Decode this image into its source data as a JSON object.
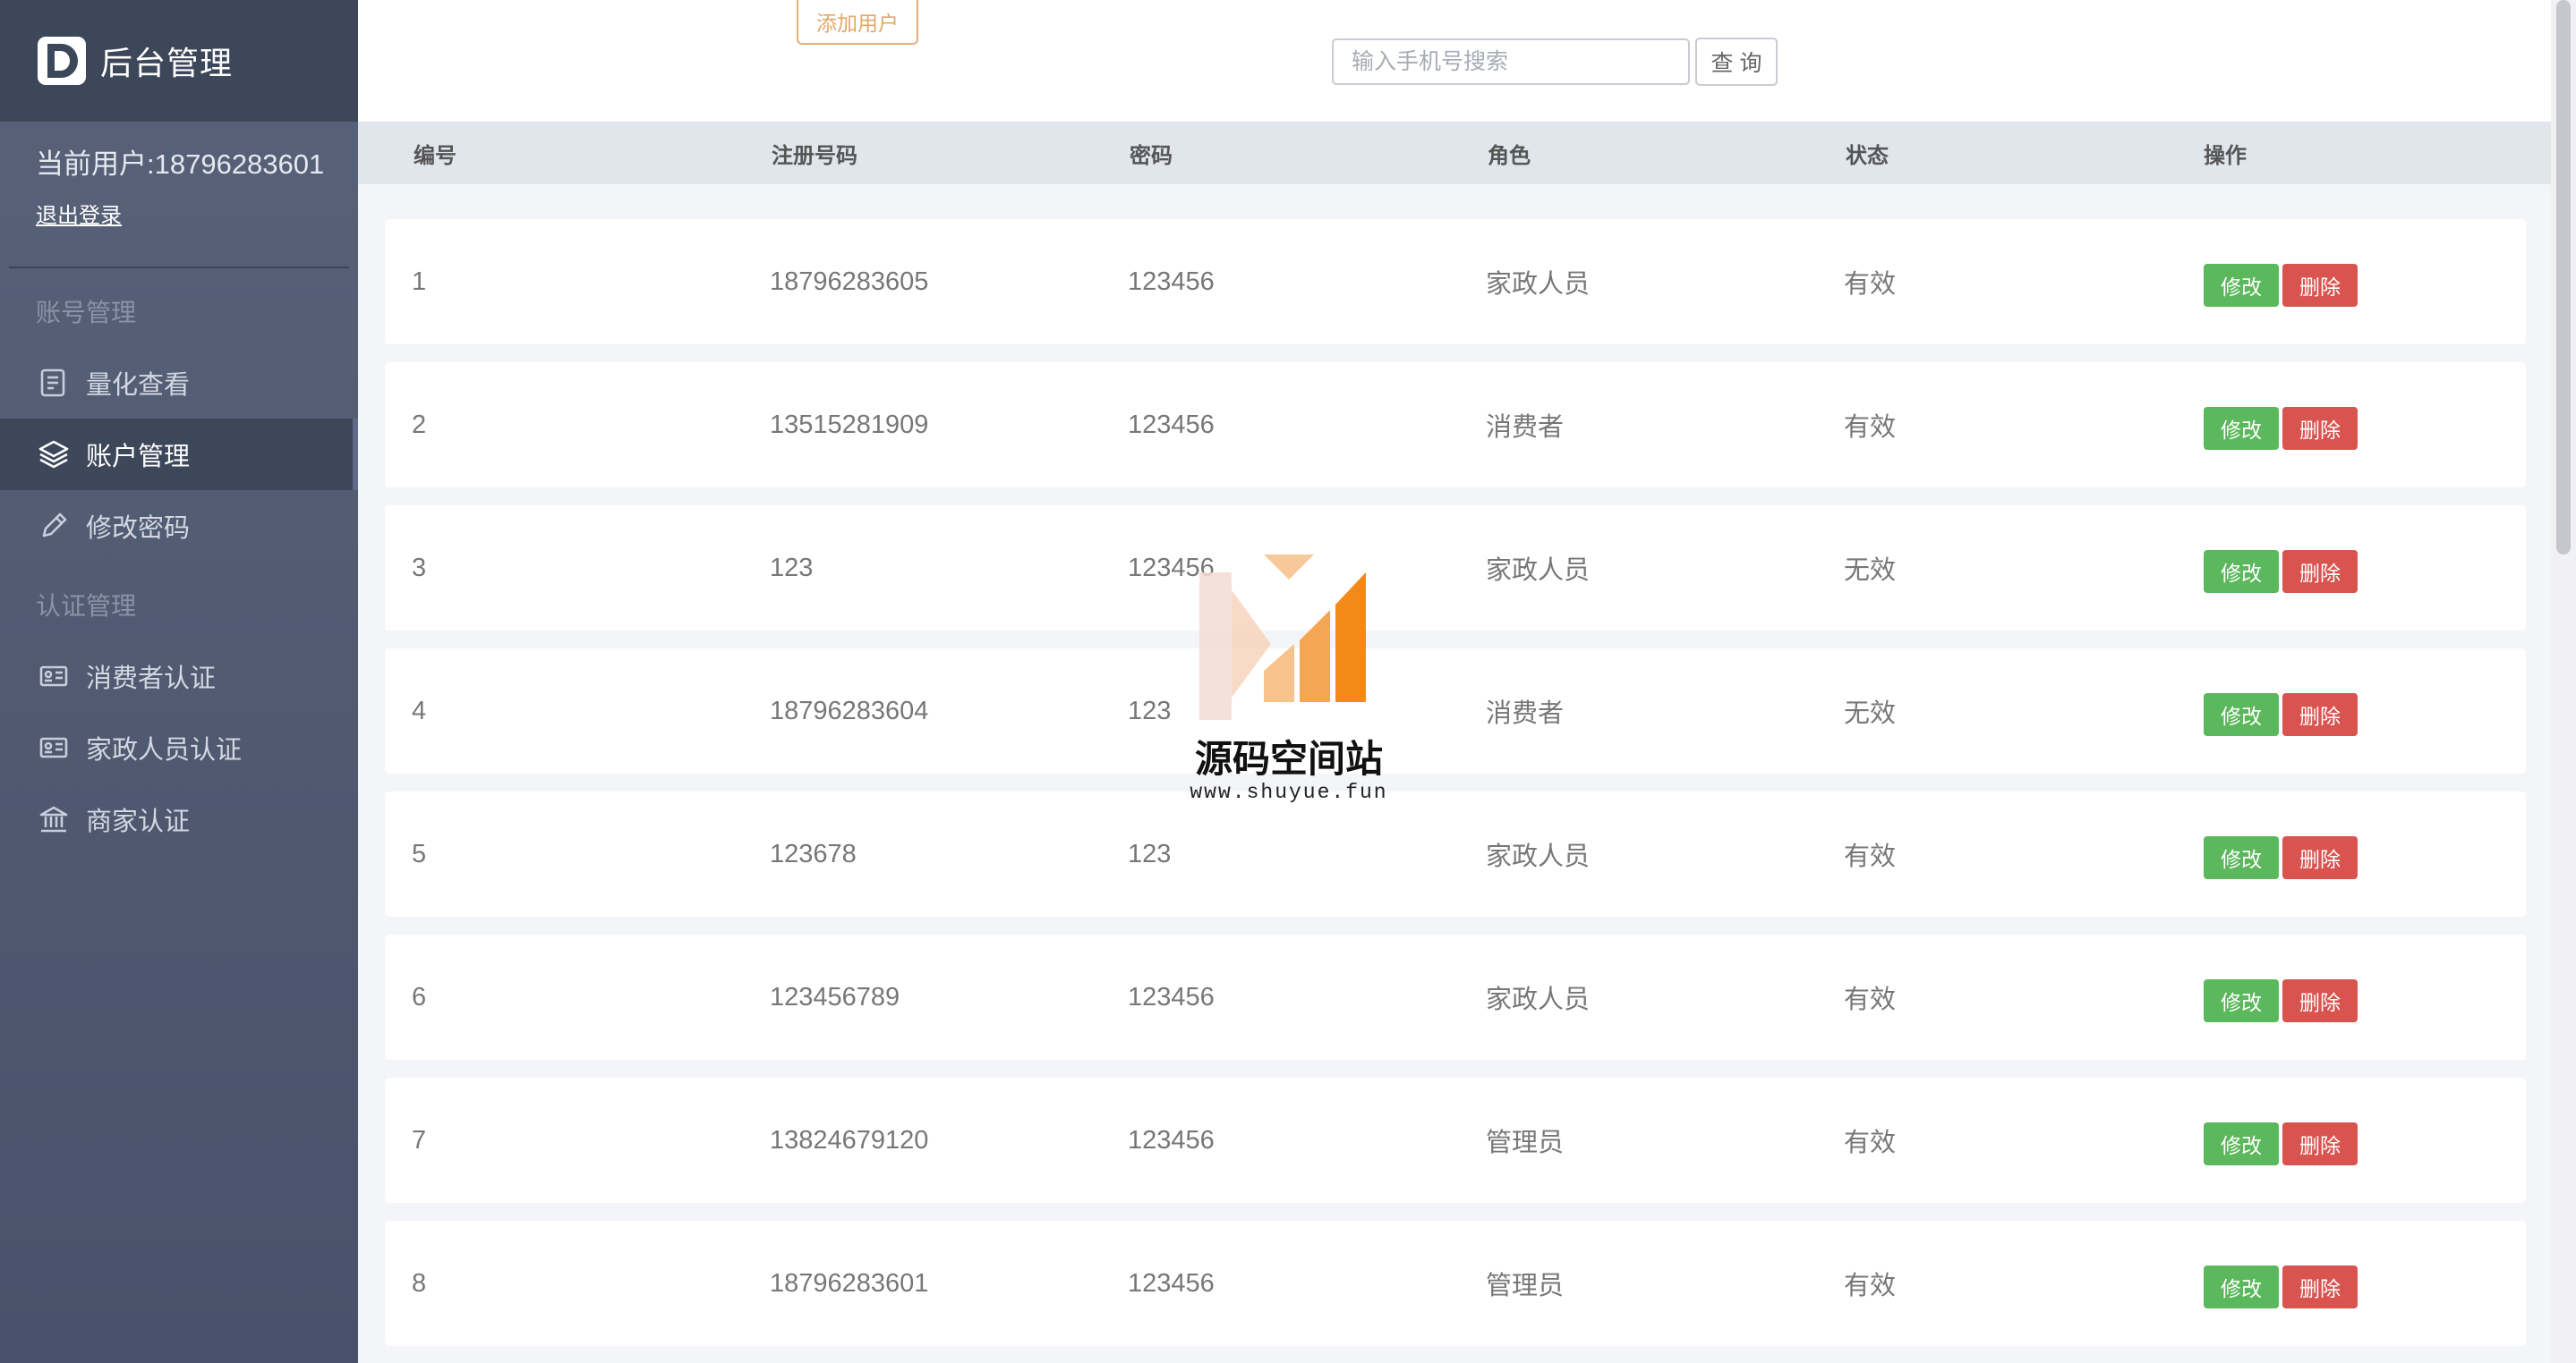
{
  "brand": {
    "logo_letter": "D",
    "title": "后台管理"
  },
  "user": {
    "current": "当前用户:18796283601",
    "logout": "退出登录"
  },
  "nav": {
    "groups": [
      {
        "title": "账号管理",
        "items": [
          {
            "label": "量化查看",
            "icon": "report-icon"
          },
          {
            "label": "账户管理",
            "icon": "layers-icon",
            "active": true
          },
          {
            "label": "修改密码",
            "icon": "pencil-icon"
          }
        ]
      },
      {
        "title": "认证管理",
        "items": [
          {
            "label": "消费者认证",
            "icon": "id-card-icon"
          },
          {
            "label": "家政人员认证",
            "icon": "id-card-icon"
          },
          {
            "label": "商家认证",
            "icon": "bank-icon"
          }
        ]
      }
    ]
  },
  "toolbar": {
    "add_user": "添加用户",
    "search_placeholder": "输入手机号搜索",
    "search_value": "",
    "query": "查 询"
  },
  "table": {
    "headers": [
      "编号",
      "注册号码",
      "密码",
      "角色",
      "状态",
      "操作"
    ],
    "rows": [
      [
        "1",
        "18796283605",
        "123456",
        "家政人员",
        "有效"
      ],
      [
        "2",
        "13515281909",
        "123456",
        "消费者",
        "有效"
      ],
      [
        "3",
        "123",
        "123456",
        "家政人员",
        "无效"
      ],
      [
        "4",
        "18796283604",
        "123",
        "消费者",
        "无效"
      ],
      [
        "5",
        "123678",
        "123",
        "家政人员",
        "有效"
      ],
      [
        "6",
        "123456789",
        "123456",
        "家政人员",
        "有效"
      ],
      [
        "7",
        "13824679120",
        "123456",
        "管理员",
        "有效"
      ],
      [
        "8",
        "18796283601",
        "123456",
        "管理员",
        "有效"
      ]
    ],
    "edit_label": "修改",
    "delete_label": "删除"
  },
  "watermark": {
    "title": "源码空间站",
    "url": "www.shuyue.fun"
  },
  "colors": {
    "sidebar": "#4f5970",
    "brand_bar": "#3d475a",
    "edit": "#5cb85c",
    "delete": "#d9534f",
    "add_border": "#e2b07c"
  }
}
